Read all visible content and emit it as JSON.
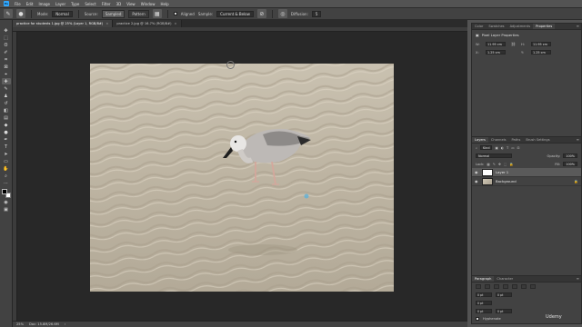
{
  "menubar": {
    "app_icon": "Ps",
    "items": [
      "File",
      "Edit",
      "Image",
      "Layer",
      "Type",
      "Select",
      "Filter",
      "3D",
      "View",
      "Window",
      "Help"
    ]
  },
  "options": {
    "tool_icon": "spot-healing-brush-icon",
    "mode_label": "Mode:",
    "mode_value": "Normal",
    "source_label": "Source:",
    "source_sampled": "Sampled",
    "source_pattern": "Pattern",
    "aligned_label": "Aligned",
    "sample_label": "Sample:",
    "sample_value": "Current & Below",
    "diffusion_label": "Diffusion:",
    "diffusion_value": "5"
  },
  "tabs": [
    {
      "label": "practice for students 1.jpg @ 25% (Layer 1, RGB/8#)",
      "active": true
    },
    {
      "label": "practice 2.jpg @ 16.7% (RGB/8#)",
      "active": false
    }
  ],
  "status": {
    "zoom": "25%",
    "doc": "Doc: 15.8M/26.6M"
  },
  "properties": {
    "tabs": [
      "Color",
      "Swatches",
      "Adjustments",
      "Properties"
    ],
    "active_tab": "Properties",
    "title": "Pixel Layer Properties",
    "w_label": "W:",
    "w_value": "11.95 cm",
    "h_label": "H:",
    "h_value": "11.95 cm",
    "x_label": "X:",
    "x_value": "1.25 cm",
    "y_label": "Y:",
    "y_value": "1.25 cm"
  },
  "layers": {
    "tabs": [
      "Layers",
      "Channels",
      "Paths",
      "Brush Settings"
    ],
    "active_tab": "Layers",
    "kind_label": "Kind",
    "blend_mode": "Normal",
    "opacity_label": "Opacity:",
    "opacity_value": "100%",
    "lock_label": "Lock:",
    "fill_label": "Fill:",
    "fill_value": "100%",
    "items": [
      {
        "name": "Layer 1",
        "selected": true
      },
      {
        "name": "Background",
        "selected": false
      }
    ]
  },
  "paragraph": {
    "tabs": [
      "Paragraph",
      "Character"
    ],
    "active_tab": "Paragraph",
    "indent_values": [
      "0 pt",
      "0 pt",
      "0 pt",
      "0 pt",
      "0 pt"
    ],
    "hyphenate_label": "Hyphenate"
  },
  "watermark": "Udemy"
}
